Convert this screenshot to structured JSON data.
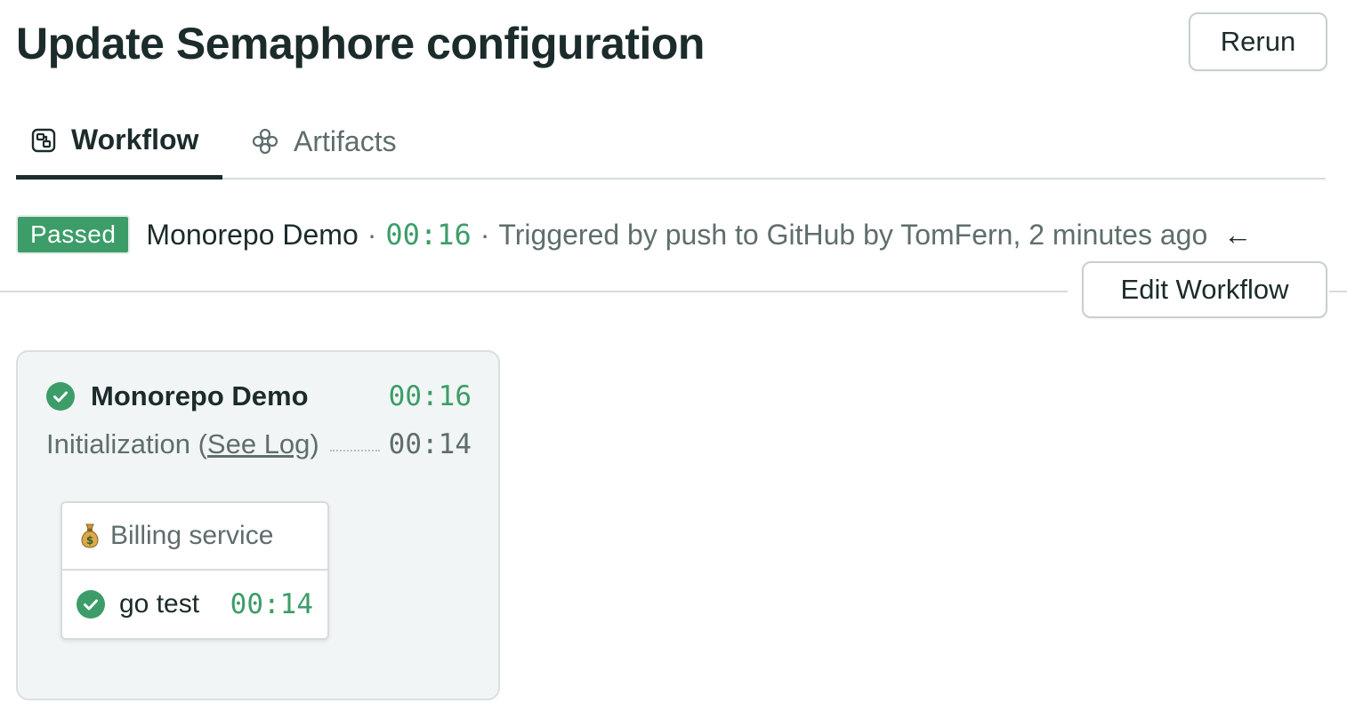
{
  "page": {
    "title": "Update Semaphore configuration",
    "rerun_label": "Rerun"
  },
  "tabs": [
    {
      "label": "Workflow",
      "icon": "workflow-icon",
      "active": true
    },
    {
      "label": "Artifacts",
      "icon": "artifacts-icon",
      "active": false
    }
  ],
  "status": {
    "badge": "Passed",
    "pipeline_name": "Monorepo Demo",
    "separator": "·",
    "duration": "00:16",
    "trigger_text": "Triggered by push to GitHub by TomFern, 2 minutes ago",
    "back_icon": "left-arrow-icon"
  },
  "edit_workflow_label": "Edit Workflow",
  "block": {
    "name": "Monorepo Demo",
    "duration": "00:16",
    "init_label": "Initialization (",
    "see_log_label": "See Log",
    "init_close": ")",
    "init_duration": "00:14",
    "job_group": {
      "icon": "money-bag-icon",
      "name": "Billing service",
      "jobs": [
        {
          "name": "go test",
          "duration": "00:14",
          "status": "passed"
        }
      ]
    }
  },
  "colors": {
    "passed": "#3c9d68",
    "text_dark": "#1c2b2b",
    "text_muted": "#5f6d6d",
    "border": "#d5dcdc",
    "block_bg": "#f2f5f5"
  }
}
